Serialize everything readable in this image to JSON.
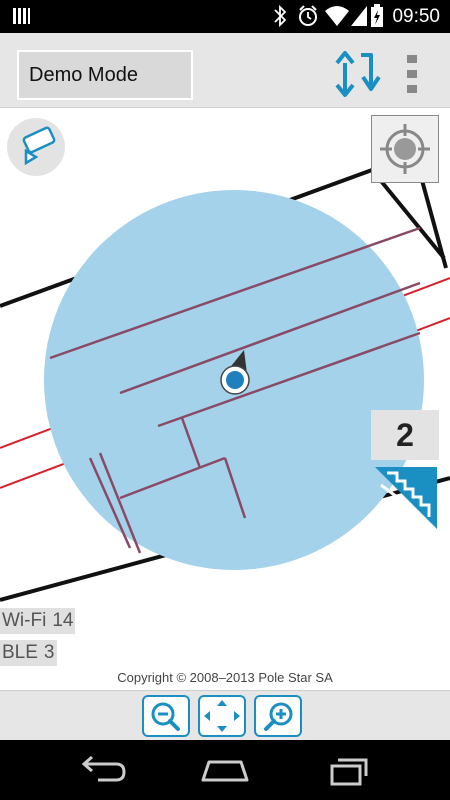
{
  "status_bar": {
    "time": "09:50"
  },
  "action_bar": {
    "mode_label": "Demo Mode"
  },
  "map": {
    "floor_number": "2",
    "copyright": "Copyright © 2008–2013 Pole Star SA"
  },
  "signals": [
    {
      "label": "Wi-Fi",
      "value": "14"
    },
    {
      "label": "BLE",
      "value": "3"
    }
  ],
  "colors": {
    "accent": "#1a8fc2",
    "accuracy_circle": "#a3d2ea",
    "location_dot": "#1f7fbf"
  },
  "icons": [
    "camera-icon",
    "locate-icon",
    "stairs-icon",
    "swap-arrows-icon",
    "overflow-menu-icon",
    "zoom-out-icon",
    "pan-icon",
    "zoom-in-icon",
    "back-icon",
    "home-icon",
    "recent-apps-icon"
  ]
}
